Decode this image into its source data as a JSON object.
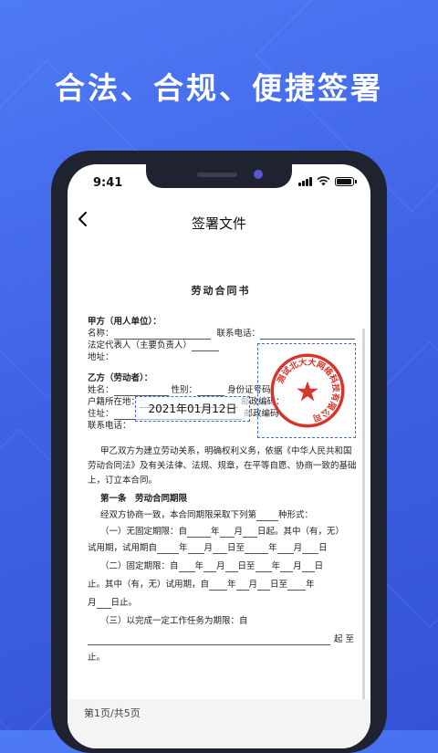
{
  "headline": "合法、合规、便捷签署",
  "status": {
    "time": "9:41"
  },
  "nav": {
    "title": "签署文件"
  },
  "doc": {
    "title": "劳动合同书",
    "party_a": "甲方（用人单位）：",
    "name": "名称：",
    "contact_phone": "联系电话：",
    "legal_rep": "法定代表人（主要负责人）",
    "address": "地址：",
    "party_b": "乙方（劳动者）：",
    "b_name": "姓名：",
    "gender": "性别：",
    "id_no": "身份证号码：",
    "household": "户籍所在地：",
    "postcode": "邮政编码：",
    "residence": "住址：",
    "postcode2": "邮政编码",
    "b_phone": "联系电话：",
    "para1_l1": "甲乙双方为建立劳动关系，明确权利义务，依据《中华人民共和国",
    "para1_l2": "劳动合同法》及有关法律、法规、规章，在平等自愿、协商一致的基础",
    "para1_l3": "上，订立本合同。",
    "article1": "第一条　劳动合同期限",
    "a1_l1_pre": "经双方协商一致，本合同期限采取下列第",
    "a1_l1_post": "种形式：",
    "a1_1_pre": "（一）无固定期限：自",
    "a1_1_post": "日起。其中（有，无）",
    "a1_1b": "试用期，试用期自",
    "a1_2": "（二）固定期限：自",
    "a1_2b_pre": "止。其中（有，无）试用期，自",
    "a1_2c": "日止。",
    "a1_3": "（三）以完成一定工作任务为期限：自",
    "a1_3_end": "起 至",
    "stop": "止。",
    "y": "年",
    "m": "月",
    "d": "日",
    "d_to": "日至"
  },
  "date_field": "2021年01月12日",
  "seal": {
    "text": "测试北大大网络科技有限公司",
    "color": "#d9342b"
  },
  "footer": {
    "page": "第1页/共5页"
  },
  "colors": {
    "accent": "#3f63e6",
    "dashed": "#3b6fe0"
  }
}
